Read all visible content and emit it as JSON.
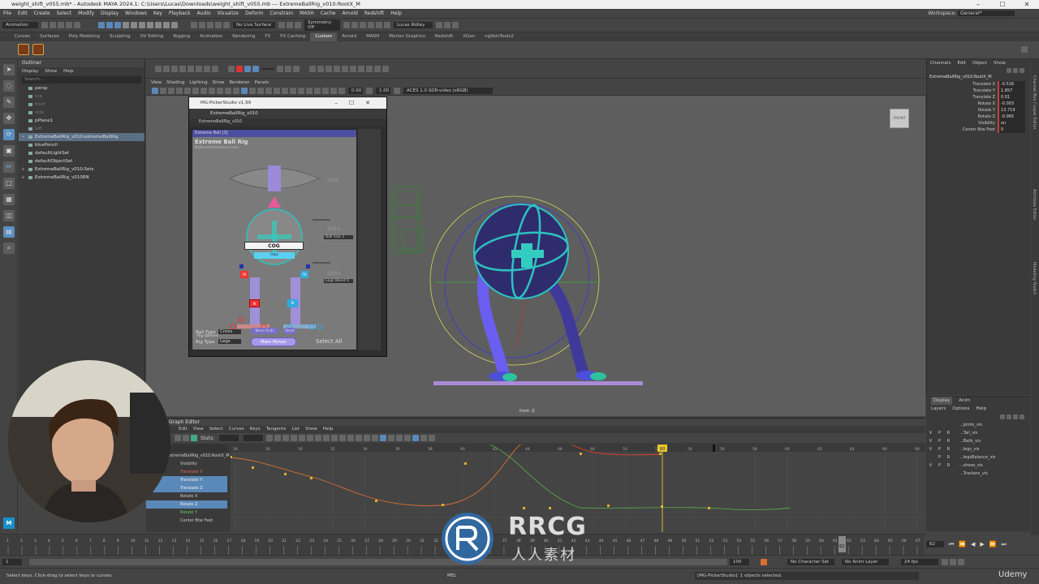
{
  "window": {
    "title": "weight_shift_v055.mb* - Autodesk MAYA 2024.1: C:\\Users\\Lucas\\Downloads\\weight_shift_v055.mb   ---   ExtremeBallRig_v010:RootX_M",
    "minimize": "–",
    "maximize": "☐",
    "close": "✕"
  },
  "menu": [
    "File",
    "Edit",
    "Create",
    "Select",
    "Modify",
    "Display",
    "Windows",
    "Key",
    "Playback",
    "Audio",
    "Visualize",
    "Deform",
    "Constrain",
    "MASH",
    "Cache",
    "Arnold",
    "Redshift",
    "Help"
  ],
  "workspace": {
    "label": "Workspace:",
    "value": "General*"
  },
  "statusline": {
    "menuset": "Animation",
    "live_surface": "No Live Surface",
    "symmetry": "Symmetry: Off",
    "user": "Lucas Ridley"
  },
  "shelf_tabs": [
    "Curves",
    "Surfaces",
    "Poly Modeling",
    "Sculpting",
    "UV Editing",
    "Rigging",
    "Animation",
    "Rendering",
    "FX",
    "FX Caching",
    "Custom",
    "Arnold",
    "MASH",
    "Motion Graphics",
    "Redshift",
    "XGen",
    "ngSkinTools2"
  ],
  "shelf_active": "Custom",
  "outliner": {
    "title": "Outliner",
    "menu": [
      "Display",
      "Show",
      "Help"
    ],
    "search_placeholder": "Search...",
    "items": [
      {
        "label": "persp",
        "dim": false
      },
      {
        "label": "top",
        "dim": true
      },
      {
        "label": "front",
        "dim": true
      },
      {
        "label": "side",
        "dim": true
      },
      {
        "label": "pPlane1",
        "dim": false
      },
      {
        "label": "left",
        "dim": true
      },
      {
        "label": "ExtremeBallRig_v010:extremeBallRig",
        "dim": false,
        "hl": true,
        "tree": true
      },
      {
        "label": "bluePencil",
        "dim": false
      },
      {
        "label": "defaultLightSet",
        "dim": false
      },
      {
        "label": "defaultObjectSet",
        "dim": false
      },
      {
        "label": "ExtremeBallRig_v010:Sets",
        "dim": false,
        "tree": true
      },
      {
        "label": "ExtremeBallRig_v010RN",
        "dim": false,
        "tree": true
      }
    ]
  },
  "viewport": {
    "menu": [
      "View",
      "Shading",
      "Lighting",
      "Show",
      "Renderer",
      "Panels"
    ],
    "exposure": "0.00",
    "gamma": "1.00",
    "color_space": "ACES 1.0 SDR-video (sRGB)",
    "camera_label": "front -Z",
    "view_cube": "FRONT"
  },
  "picker": {
    "title": "MG-PickerStudio v1.99",
    "tab": "ExtremeBallRig_v010",
    "subtab": "ExtremeBallRig_v010",
    "header": "Extreme Ball [3]",
    "rig_title": "Extreme Ball Rig",
    "rig_subtitle": "BaBoonAnimations.com",
    "tail_label": "TAIL",
    "ball_label": "BALL",
    "legs_label": "LEGS",
    "ball_size": "Ball Size  1",
    "legs_blend": "Legs Blend  0",
    "cog": "COG",
    "hips": "Hips",
    "fk": "FK",
    "ik": "IK",
    "rig_options": "Rig Options",
    "ball_type_label": "Ball Type",
    "ball_type_value": "Cross",
    "rig_type_label": "Rig Type",
    "rig_type_value": "Legs",
    "never_ends": "Never Ends",
    "reset": "Reset",
    "main_mover": "Main Mover",
    "select_all": "Select All"
  },
  "channelbox": {
    "tabs": [
      "Channels",
      "Edit",
      "Object",
      "Show"
    ],
    "object": "ExtremeBallRig_v010:RootX_M",
    "channels": [
      {
        "name": "Translate X",
        "value": "-0.518"
      },
      {
        "name": "Translate Y",
        "value": "1.857"
      },
      {
        "name": "Translate Z",
        "value": "0.01"
      },
      {
        "name": "Rotate X",
        "value": "-0.003"
      },
      {
        "name": "Rotate Y",
        "value": "13.719"
      },
      {
        "name": "Rotate Z",
        "value": "-0.065"
      },
      {
        "name": "Visibility",
        "value": "on"
      },
      {
        "name": "Center Btw Feet",
        "value": "0"
      }
    ],
    "side_tabs": [
      "Channel Box / Layer Editor",
      "Attribute Editor",
      "Modeling Toolkit"
    ]
  },
  "layers": {
    "tabs": [
      "Display",
      "Anim"
    ],
    "menu": [
      "Layers",
      "Options",
      "Help"
    ],
    "rows": [
      {
        "v": "",
        "p": "",
        "r": "",
        "name": "...Joints_vis"
      },
      {
        "v": "V",
        "p": "P",
        "r": "R",
        "name": "...Tail_vis"
      },
      {
        "v": "V",
        "p": "P",
        "r": "R",
        "name": "...Balls_vis"
      },
      {
        "v": "V",
        "p": "P",
        "r": "R",
        "name": "...legs_vis"
      },
      {
        "v": "",
        "p": "P",
        "r": "R",
        "name": "...legsBalance_vis"
      },
      {
        "v": "V",
        "p": "P",
        "r": "R",
        "name": "...shoes_vis"
      },
      {
        "v": "",
        "p": "",
        "r": "",
        "name": "...Trackers_vis"
      }
    ]
  },
  "graph_editor": {
    "title": "Graph Editor",
    "menu": [
      "Edit",
      "View",
      "Select",
      "Curves",
      "Keys",
      "Tangents",
      "List",
      "Show",
      "Help"
    ],
    "stats_label": "Stats:",
    "object": "ExtremeBallRig_v010:RootX_M",
    "channels": [
      {
        "label": "Visibility",
        "cls": ""
      },
      {
        "label": "Translate X",
        "cls": "red"
      },
      {
        "label": "Translate Y",
        "cls": "sel"
      },
      {
        "label": "Translate Z",
        "cls": "sel"
      },
      {
        "label": "Rotate X",
        "cls": ""
      },
      {
        "label": "Rotate Z",
        "cls": "sel"
      },
      {
        "label": "Rotate Y",
        "cls": "grn"
      },
      {
        "label": "Center Btw Feet",
        "cls": ""
      }
    ],
    "current_frame": "60",
    "ruler": [
      "26",
      "28",
      "30",
      "32",
      "34",
      "36",
      "38",
      "40",
      "42",
      "44",
      "46",
      "48",
      "50",
      "52",
      "54",
      "56",
      "58",
      "60",
      "62",
      "64",
      "66",
      "68"
    ]
  },
  "timeline": {
    "ticks": [
      "1",
      "2",
      "3",
      "4",
      "5",
      "6",
      "7",
      "8",
      "9",
      "10",
      "11",
      "12",
      "13",
      "14",
      "15",
      "16",
      "17",
      "18",
      "19",
      "20",
      "21",
      "22",
      "23",
      "24",
      "25",
      "26",
      "27",
      "28",
      "29",
      "30",
      "31",
      "32",
      "33",
      "34",
      "35",
      "36",
      "37",
      "38",
      "39",
      "40",
      "41",
      "42",
      "43",
      "44",
      "45",
      "46",
      "47",
      "48",
      "49",
      "50",
      "51",
      "52",
      "53",
      "54",
      "55",
      "56",
      "57",
      "58",
      "59",
      "60",
      "61",
      "62",
      "63",
      "64",
      "65",
      "66",
      "67"
    ],
    "current": "62",
    "range_start": "1",
    "range_end": "100",
    "character_set": "No Character Set",
    "anim_layer": "No Anim Layer",
    "fps": "24 fps"
  },
  "helpline": {
    "text": "Select keys. Click-drag to select keys or curves",
    "mel": "MEL",
    "result": "[MG-PickerStudio]: 1 objects selected."
  },
  "watermark": {
    "brand": "RRCG",
    "sub": "人人素材",
    "udemy": "Udemy"
  }
}
